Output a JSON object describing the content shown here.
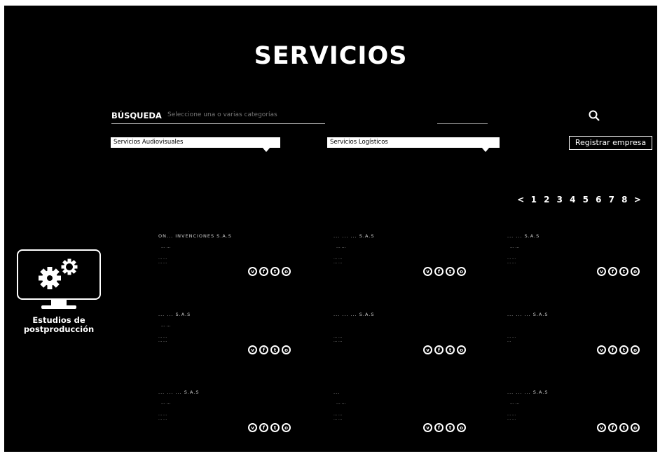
{
  "page": {
    "title": "SERVICIOS"
  },
  "search": {
    "label": "BÚSQUEDA",
    "placeholder": "Seleccione una o varias categorías"
  },
  "filters": {
    "audiovisual": "Servicios Audiovisuales",
    "logistic": "Servicios Logísticos",
    "register_label": "Registrar empresa"
  },
  "pagination": {
    "prev": "<",
    "pages": [
      "1",
      "2",
      "3",
      "4",
      "5",
      "6",
      "7",
      "8"
    ],
    "next": ">"
  },
  "category": {
    "label_line1": "Estudios de",
    "label_line2": "postproducción",
    "icon": "gear-icon"
  },
  "social_icons": [
    "v",
    "f",
    "t",
    "o"
  ],
  "cards": [
    {
      "name": "ON... INVENCIONES S.A.S",
      "sub": "... ...",
      "info": "... ...\n... ..."
    },
    {
      "name": "... ... ... S.A.S",
      "sub": "... ...",
      "info": "... ...\n... ..."
    },
    {
      "name": "... ... S.A.S",
      "sub": "... ...",
      "info": "... ...\n... ..."
    },
    {
      "name": "... ... S.A.S",
      "sub": "... ...",
      "info": "... ...\n... ..."
    },
    {
      "name": "... ... ... S.A.S",
      "sub": "",
      "info": "... ...\n... ..."
    },
    {
      "name": "... ... ... S.A.S",
      "sub": "",
      "info": "... ...\n..."
    },
    {
      "name": "... ... ... S.A.S",
      "sub": "... ...",
      "info": "... ...\n... ..."
    },
    {
      "name": "...",
      "sub": "... ...",
      "info": "... ...\n... ..."
    },
    {
      "name": "... ... ... S.A.S",
      "sub": "... ...",
      "info": "... ...\n... ..."
    }
  ]
}
